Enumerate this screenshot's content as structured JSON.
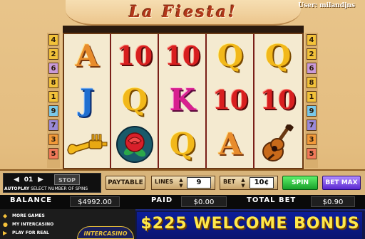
{
  "title": "La Fiesta!",
  "user_label": "User: milandjns",
  "paylines_left": [
    "4",
    "2",
    "6",
    "8",
    "1",
    "9",
    "7",
    "3",
    "5"
  ],
  "paylines_right": [
    "4",
    "2",
    "6",
    "8",
    "1",
    "9",
    "7",
    "3",
    "5"
  ],
  "reels": [
    [
      "A",
      "J",
      "trumpet-icon"
    ],
    [
      "10",
      "Q",
      "rose-icon"
    ],
    [
      "10",
      "K",
      "Q"
    ],
    [
      "Q",
      "10",
      "A"
    ],
    [
      "Q",
      "10",
      "guitar-icon"
    ]
  ],
  "autoplay": {
    "value": "01",
    "stop_label": "STOP",
    "label_bold": "AUTOPLAY",
    "label_rest": "SELECT NUMBER OF SPINS"
  },
  "controls": {
    "paytable_label": "PAYTABLE",
    "lines_label": "LINES",
    "lines_value": "9",
    "bet_label": "BET",
    "bet_value": "10¢",
    "spin_label": "SPIN",
    "betmax_label": "BET MAX"
  },
  "balance": {
    "balance_label": "BALANCE",
    "balance_value": "$4992.00",
    "paid_label": "PAID",
    "paid_value": "$0.00",
    "total_bet_label": "TOTAL BET",
    "total_bet_value": "$0.90"
  },
  "menu": {
    "items": [
      "MORE GAMES",
      "MY INTERCASINO",
      "PLAY FOR REAL"
    ],
    "logo_text": "INTERCASINO"
  },
  "promo": {
    "text": "$225 WELCOME BONUS"
  },
  "colors": {
    "reel_divider": "#7a1f18",
    "spin_green": "#18a02a",
    "betmax_purple": "#5a28d0",
    "promo_yellow": "#ffe84a"
  }
}
